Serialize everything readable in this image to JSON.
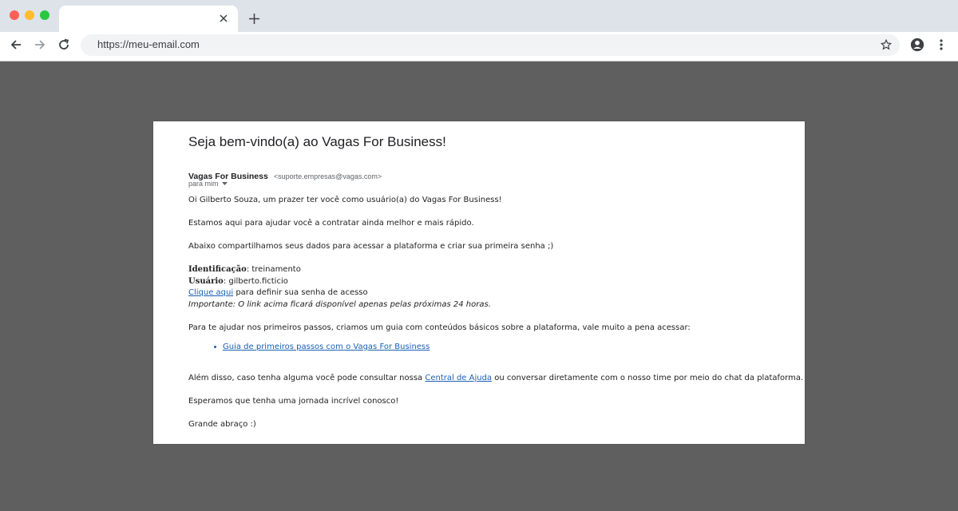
{
  "browser": {
    "url": "https://meu-email.com"
  },
  "email": {
    "subject": "Seja bem-vindo(a) ao Vagas For Business!",
    "sender_name": "Vagas For Business",
    "sender_email": "<suporte.empresas@vagas.com>",
    "recipient": "para mim",
    "greeting": "Oi Gilberto Souza, um prazer ter você como usuário(a) do Vagas For Business!",
    "intro": "Estamos aqui para ajudar você a contratar ainda melhor e mais rápido.",
    "share_text": "Abaixo compartilhamos seus dados para acessar a plataforma e criar sua primeira senha ;)",
    "identification_label": "Identificação",
    "identification_value": ": treinamento",
    "user_label": "Usuário",
    "user_value": ": gilberto.ficticio",
    "click_here_link": "Clique aqui",
    "click_here_text": " para definir sua senha de acesso",
    "important_note": "Importante: O link acima ficará disponível apenas pelas próximas 24 horas.",
    "guide_intro": "Para te ajudar nos primeiros passos, criamos um guia com conteúdos básicos sobre a plataforma, vale muito a pena acessar:",
    "guide_link": "Guia de primeiros passos com o Vagas For Business",
    "help_before": "Além disso, caso tenha alguma você pode consultar nossa ",
    "help_link": "Central de Ajuda",
    "help_after": " ou conversar diretamente com o nosso time por meio do chat da plataforma.",
    "journey": "Esperamos que tenha uma jornada incrível conosco!",
    "signoff": "Grande abraço :)"
  }
}
